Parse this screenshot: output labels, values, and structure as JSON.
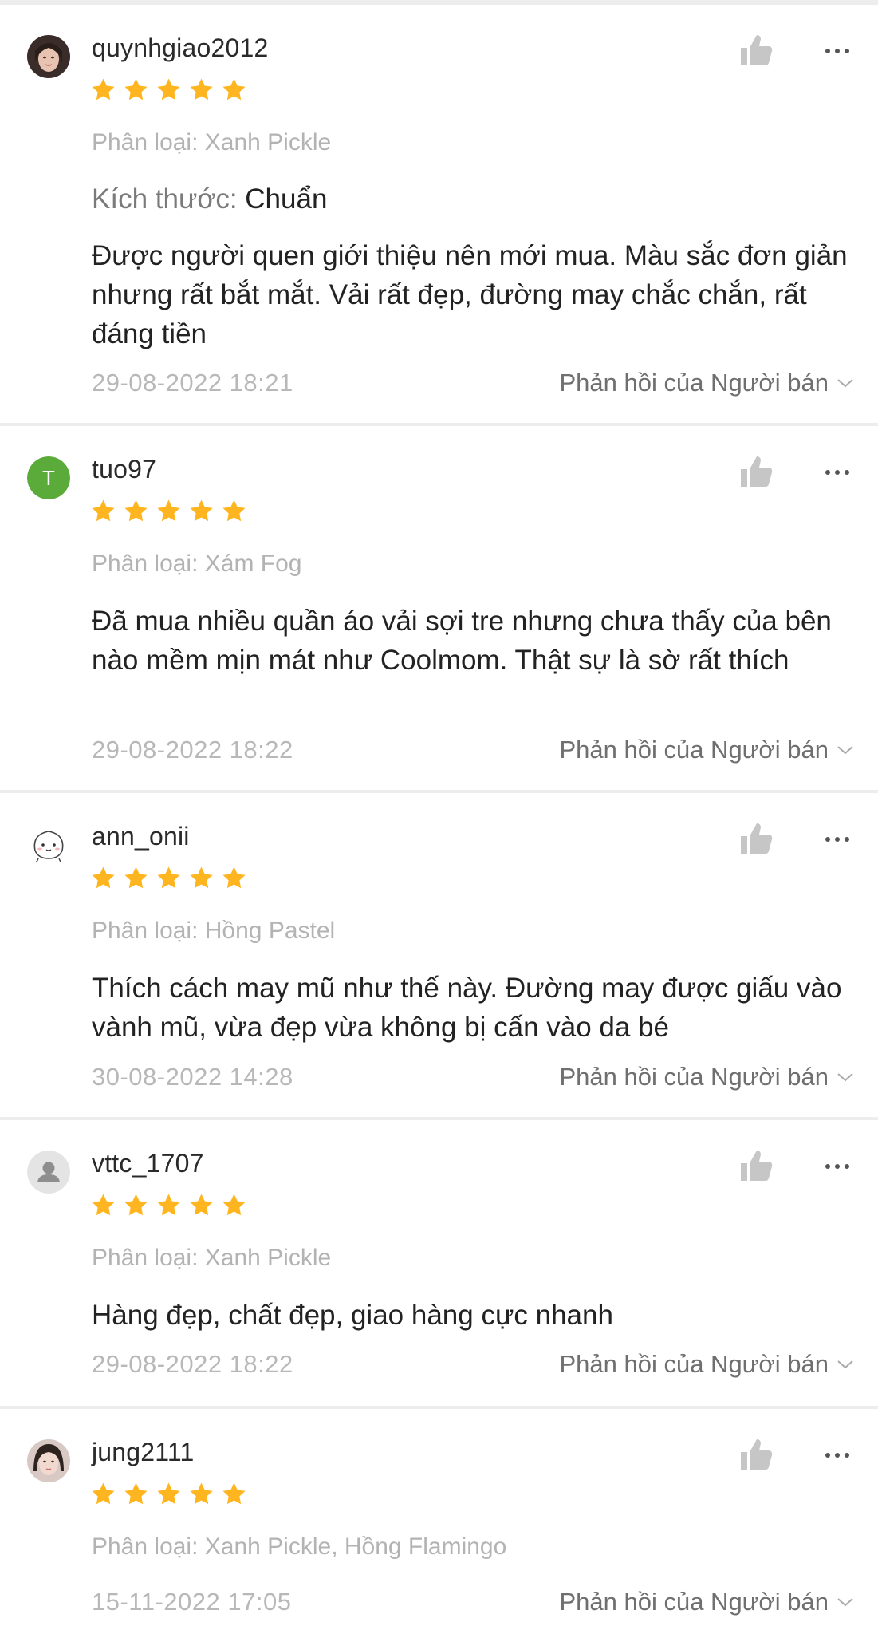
{
  "reviews": [
    {
      "username": "quynhgiao2012",
      "avatar": "photo-avatar-girl",
      "rating": 5,
      "variant": "Phân loại: Xanh Pickle",
      "size_label": "Kích thước: ",
      "size_value": "Chuẩn",
      "comment": "Được người quen giới thiệu nên mới mua. Màu sắc đơn giản nhưng rất bắt mắt. Vải rất đẹp, đường may chắc chắn, rất đáng tiền",
      "date": "29-08-2022 18:21",
      "reply_label": "Phản hồi của Người bán"
    },
    {
      "username": "tuo97",
      "avatar": "letter-avatar",
      "avatar_letter": "T",
      "rating": 5,
      "variant": "Phân loại: Xám Fog",
      "comment": "Đã mua nhiều quần áo vải sợi tre nhưng chưa thấy của bên nào mềm mịn mát như Coolmom. Thật sự là sờ rất thích",
      "date": "29-08-2022 18:22",
      "reply_label": "Phản hồi của Người bán"
    },
    {
      "username": "ann_onii",
      "avatar": "cartoon-face-avatar",
      "rating": 5,
      "variant": "Phân loại: Hồng Pastel",
      "comment": "Thích cách may mũ như thế này. Đường may được giấu vào vành mũ, vừa đẹp vừa không bị cấn vào da bé",
      "date": "30-08-2022 14:28",
      "reply_label": "Phản hồi của Người bán"
    },
    {
      "username": "vttc_1707",
      "avatar": "default-user-avatar",
      "rating": 5,
      "variant": "Phân loại: Xanh Pickle",
      "comment": "Hàng đẹp, chất đẹp, giao hàng cực nhanh",
      "date": "29-08-2022 18:22",
      "reply_label": "Phản hồi của Người bán"
    },
    {
      "username": "jung2111",
      "avatar": "photo-avatar-girl-2",
      "rating": 5,
      "variant": "Phân loại: Xanh Pickle, Hồng Flamingo",
      "date": "15-11-2022 17:05",
      "reply_label": "Phản hồi của Người bán"
    }
  ],
  "colors": {
    "star": "#ffb51f",
    "letter_avatar_bg": "#5bab3a",
    "icon_gray": "#c6c6c6"
  }
}
